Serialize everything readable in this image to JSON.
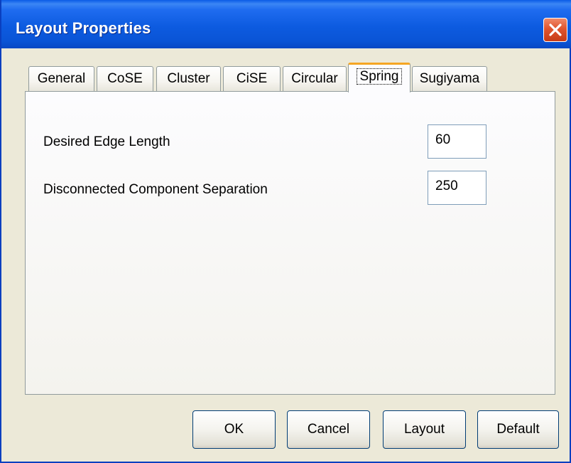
{
  "window": {
    "title": "Layout Properties"
  },
  "tabs": [
    {
      "label": "General",
      "active": false
    },
    {
      "label": "CoSE",
      "active": false
    },
    {
      "label": "Cluster",
      "active": false
    },
    {
      "label": "CiSE",
      "active": false
    },
    {
      "label": "Circular",
      "active": false
    },
    {
      "label": "Spring",
      "active": true
    },
    {
      "label": "Sugiyama",
      "active": false
    }
  ],
  "fields": {
    "edge_length": {
      "label": "Desired Edge Length",
      "value": "60"
    },
    "separation": {
      "label": "Disconnected Component Separation",
      "value": "250"
    }
  },
  "buttons": {
    "ok": "OK",
    "cancel": "Cancel",
    "layout": "Layout",
    "default": "Default"
  },
  "icons": {
    "close": "close-icon"
  },
  "colors": {
    "titlebar": "#0a54d6",
    "close_button": "#e0552e",
    "active_tab_accent": "#f5a623",
    "dialog_background": "#ece9d8"
  }
}
